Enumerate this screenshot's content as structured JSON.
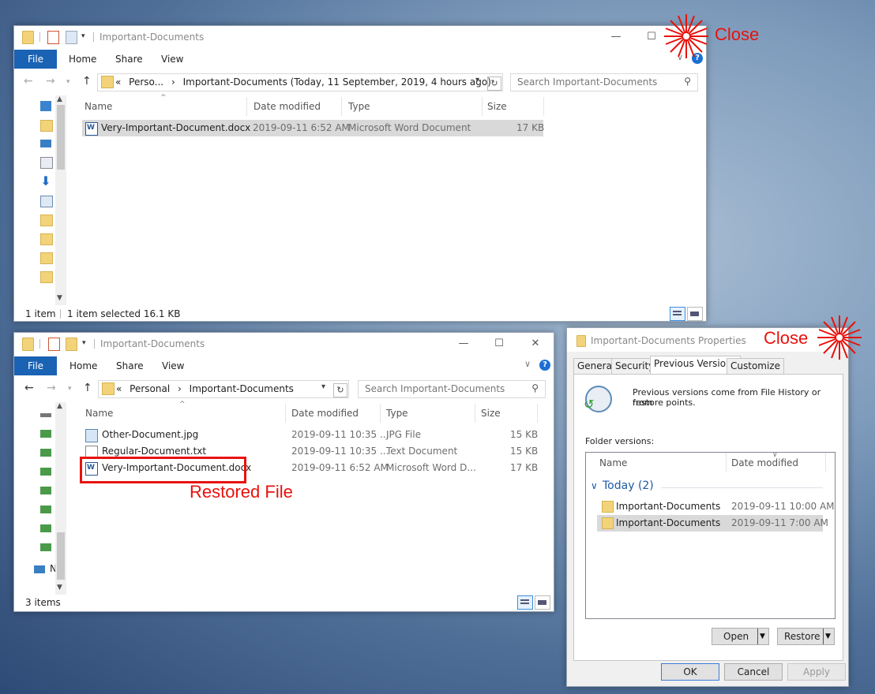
{
  "window1": {
    "title": "Important-Documents",
    "ribbon": {
      "file": "File",
      "home": "Home",
      "share": "Share",
      "view": "View"
    },
    "address": {
      "crumbs": [
        "«",
        "Perso...",
        "›",
        "Important-Documents (Today, 11 September, 2019, 4 hours ago)"
      ]
    },
    "search_placeholder": "Search Important-Documents",
    "columns": {
      "name": "Name",
      "date": "Date modified",
      "type": "Type",
      "size": "Size"
    },
    "files": [
      {
        "name": "Very-Important-Document.docx",
        "date": "2019-09-11 6:52 AM",
        "type": "Microsoft Word Document",
        "size": "17 KB"
      }
    ],
    "status": {
      "count": "1 item",
      "selected": "1 item selected  16.1 KB"
    }
  },
  "window2": {
    "title": "Important-Documents",
    "ribbon": {
      "file": "File",
      "home": "Home",
      "share": "Share",
      "view": "View"
    },
    "address": {
      "crumbs": [
        "«",
        "Personal",
        "›",
        "Important-Documents"
      ]
    },
    "search_placeholder": "Search Important-Documents",
    "columns": {
      "name": "Name",
      "date": "Date modified",
      "type": "Type",
      "size": "Size"
    },
    "files": [
      {
        "name": "Other-Document.jpg",
        "date": "2019-09-11 10:35 ...",
        "type": "JPG File",
        "size": "15 KB"
      },
      {
        "name": "Regular-Document.txt",
        "date": "2019-09-11 10:35 ...",
        "type": "Text Document",
        "size": "15 KB"
      },
      {
        "name": "Very-Important-Document.docx",
        "date": "2019-09-11 6:52 AM",
        "type": "Microsoft Word D...",
        "size": "17 KB"
      }
    ],
    "nav_partial": "N",
    "status": {
      "count": "3 items"
    }
  },
  "dialog": {
    "title": "Important-Documents Properties",
    "tabs": [
      "General",
      "Security",
      "Previous Versions",
      "Customize"
    ],
    "info": [
      "Previous versions come from File History or from",
      "restore points."
    ],
    "folder_versions_label": "Folder versions:",
    "list_columns": {
      "name": "Name",
      "date": "Date modified"
    },
    "group": "Today (2)",
    "versions": [
      {
        "name": "Important-Documents",
        "date": "2019-09-11 10:00 AM"
      },
      {
        "name": "Important-Documents",
        "date": "2019-09-11 7:00 AM"
      }
    ],
    "buttons": {
      "open": "Open",
      "restore": "Restore",
      "ok": "OK",
      "cancel": "Cancel",
      "apply": "Apply"
    }
  },
  "annotations": {
    "close1": "Close",
    "close2": "Close",
    "restored": "Restored File"
  },
  "colors": {
    "annotation": "#e8120c",
    "file_tab": "#1a62b3",
    "selection": "#d9d9d9"
  }
}
